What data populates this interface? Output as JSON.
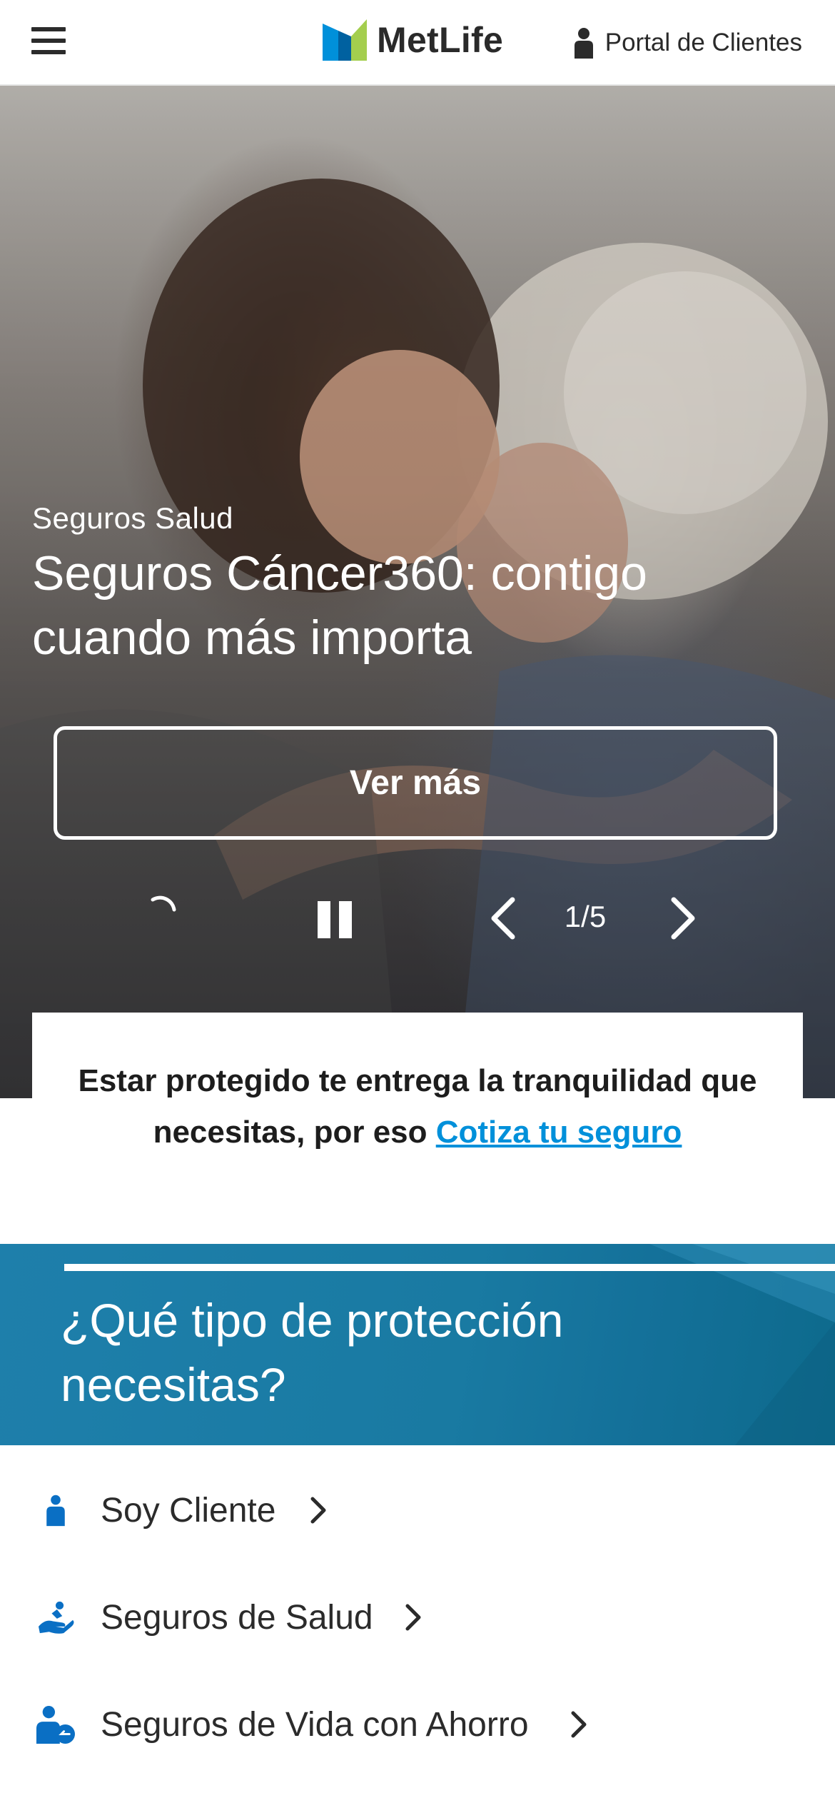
{
  "header": {
    "menu_icon": "hamburger-menu-icon",
    "brand_name": "MetLife",
    "logo_colors": [
      "#0090da",
      "#a4ce4e"
    ],
    "portal_label": "Portal de Clientes",
    "portal_icon": "person-icon"
  },
  "hero": {
    "eyebrow": "Seguros Salud",
    "title": "Seguros Cáncer360: contigo cuando más importa",
    "cta_label": "Ver más",
    "counter": "1/5",
    "controls": {
      "loading_icon": "loading-spinner-icon",
      "pause_icon": "pause-icon",
      "prev_icon": "chevron-left-icon",
      "next_icon": "chevron-right-icon"
    }
  },
  "intro": {
    "text": "Estar protegido te entrega la tranquilidad que necesitas, por eso ",
    "link_label": "Cotiza tu seguro",
    "link_color": "#0090da"
  },
  "protection": {
    "title": "¿Qué tipo de protección necesitas?",
    "background_color": "#1e7fab"
  },
  "list": {
    "icon_color": "#0a6fc4",
    "items": [
      {
        "label": "Soy Cliente",
        "icon": "person-icon"
      },
      {
        "label": "Seguros de Salud",
        "icon": "hand-care-icon"
      },
      {
        "label": "Seguros de Vida con Ahorro",
        "icon": "person-savings-icon"
      }
    ]
  }
}
